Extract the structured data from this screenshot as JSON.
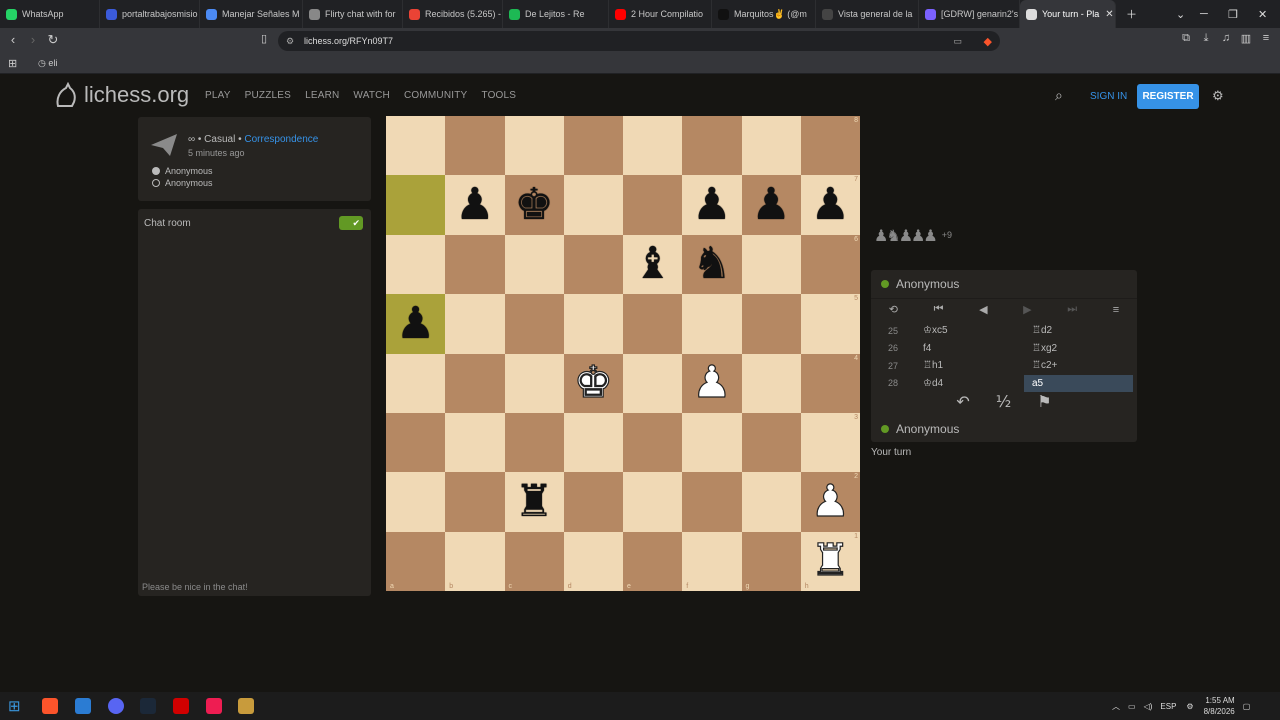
{
  "browser": {
    "tabs": [
      {
        "label": "WhatsApp",
        "color": "#25d366"
      },
      {
        "label": "portaltrabajosmisio",
        "color": "#3b5bdb"
      },
      {
        "label": "Manejar Señales M",
        "color": "#4c8bf5"
      },
      {
        "label": "Flirty chat with for",
        "color": "#888888"
      },
      {
        "label": "Recibidos (5.265) -",
        "color": "#ea4335"
      },
      {
        "label": "De Lejitos - Re",
        "color": "#1db954"
      },
      {
        "label": "2 Hour Compilatio",
        "color": "#ff0000"
      },
      {
        "label": "Marquitos✌ (@m",
        "color": "#111111"
      },
      {
        "label": "Vista general de la",
        "color": "#444444"
      },
      {
        "label": "[GDRW] genarin2's",
        "color": "#7b61ff"
      },
      {
        "label": "Your turn - Pla",
        "color": "#dddddd",
        "active": true
      }
    ],
    "url": "lichess.org/RFYn09T7",
    "bookmark": "eli"
  },
  "site": {
    "logo": "lichess.org",
    "nav": [
      "PLAY",
      "PUZZLES",
      "LEARN",
      "WATCH",
      "COMMUNITY",
      "TOOLS"
    ],
    "signin": "SIGN IN",
    "register": "REGISTER"
  },
  "game": {
    "mode_prefix": "∞ • Casual • ",
    "mode_link": "Correspondence",
    "ago": "5 minutes ago",
    "players": [
      "Anonymous",
      "Anonymous"
    ]
  },
  "chat": {
    "title": "Chat room",
    "placeholder": "Please be nice in the chat!"
  },
  "board": {
    "highlights": [
      "a7",
      "a5"
    ],
    "pieces": {
      "b7": "bP",
      "c7": "bK",
      "f7": "bP",
      "g7": "bP",
      "h7": "bP",
      "e6": "bB",
      "f6": "bN",
      "a5": "bP",
      "d4": "wK",
      "f4": "wP",
      "c2": "bR",
      "h2": "wP",
      "h1": "wR"
    },
    "files": [
      "a",
      "b",
      "c",
      "d",
      "e",
      "f",
      "g",
      "h"
    ],
    "ranks": [
      "8",
      "7",
      "6",
      "5",
      "4",
      "3",
      "2",
      "1"
    ]
  },
  "right": {
    "captured": "♟♞♟♟♟",
    "captured_plus": "+9",
    "top_player": "Anonymous",
    "bottom_player": "Anonymous",
    "moves": [
      {
        "num": "25",
        "white": "♔xc5",
        "black": "♖d2"
      },
      {
        "num": "26",
        "white": "f4",
        "black": "♖xg2"
      },
      {
        "num": "27",
        "white": "♖h1",
        "black": "♖c2+"
      },
      {
        "num": "28",
        "white": "♔d4",
        "black": "a5",
        "black_active": true
      }
    ],
    "your_turn": "Your turn"
  },
  "taskbar": {
    "lang": "ESP",
    "time": "1:55 AM",
    "date": "8/8/2026"
  }
}
